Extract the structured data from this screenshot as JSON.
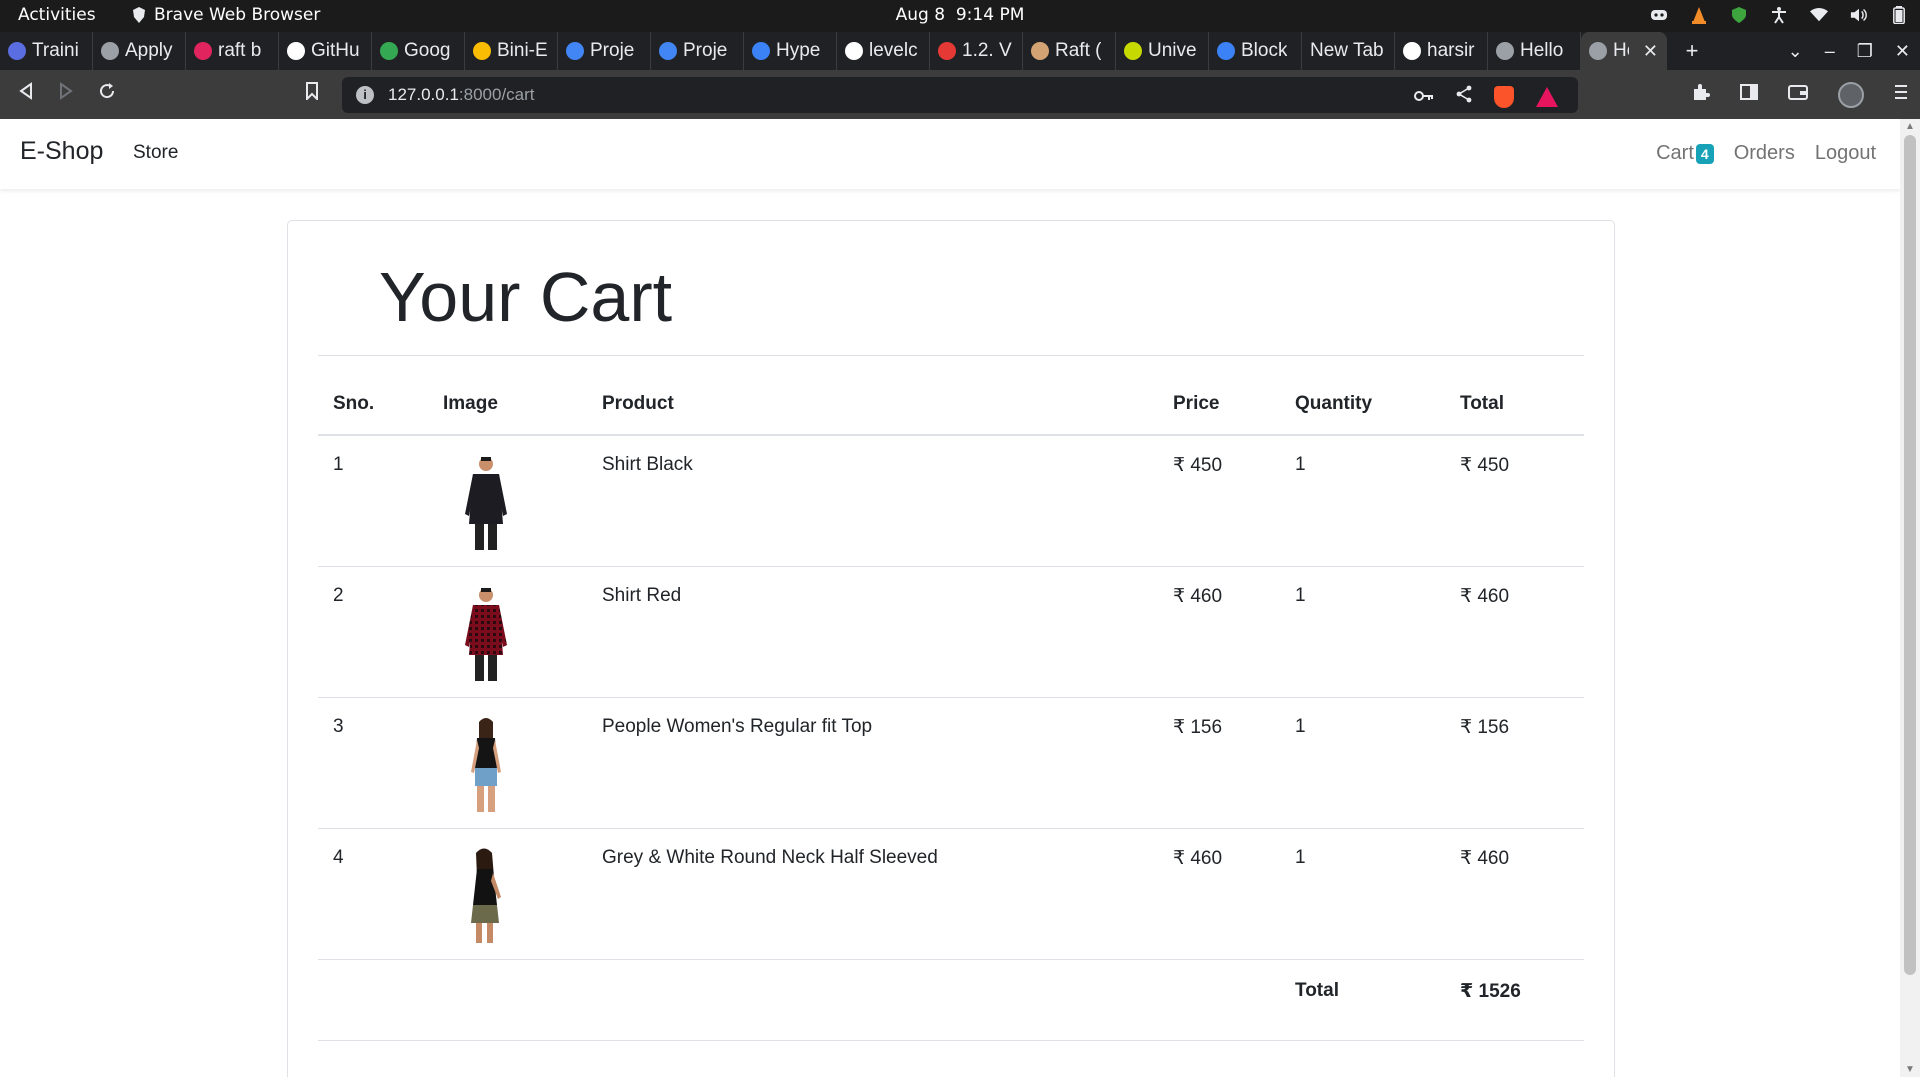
{
  "system_bar": {
    "activities": "Activities",
    "app_name": "Brave Web Browser",
    "date": "Aug 8",
    "time": "9:14 PM"
  },
  "tabs": [
    {
      "label": "Traini",
      "color": "#5b6ee1"
    },
    {
      "label": "Apply",
      "color": "#9aa0a6"
    },
    {
      "label": "raft b",
      "color": "#e0245e"
    },
    {
      "label": "GitHu",
      "color": "#ffffff"
    },
    {
      "label": "Goog",
      "color": "#34a853"
    },
    {
      "label": "Bini-E",
      "color": "#fbbc04"
    },
    {
      "label": "Proje",
      "color": "#4285f4"
    },
    {
      "label": "Proje",
      "color": "#4285f4"
    },
    {
      "label": "Hype",
      "color": "#3b82f6"
    },
    {
      "label": "levelc",
      "color": "#ffffff"
    },
    {
      "label": "1.2. V",
      "color": "#e53935"
    },
    {
      "label": "Raft (",
      "color": "#d4a373"
    },
    {
      "label": "Unive",
      "color": "#c6d900"
    },
    {
      "label": "Block",
      "color": "#3b82f6"
    },
    {
      "label": "New Tab",
      "color": ""
    },
    {
      "label": "harsir",
      "color": "#ffffff"
    },
    {
      "label": "Hello",
      "color": "#9aa0a6"
    }
  ],
  "active_tab": {
    "label": "He"
  },
  "address_bar": {
    "host": "127.0.0.1",
    "path": ":8000/cart"
  },
  "site": {
    "brand": "E-Shop",
    "nav_store": "Store",
    "nav_cart": "Cart",
    "cart_count": "4",
    "nav_orders": "Orders",
    "nav_logout": "Logout"
  },
  "cart": {
    "title": "Your Cart",
    "columns": [
      "Sno.",
      "Image",
      "Product",
      "Price",
      "Quantity",
      "Total"
    ],
    "rows": [
      {
        "sno": "1",
        "product": "Shirt Black",
        "price": "₹ 450",
        "quantity": "1",
        "total": "₹ 450",
        "image": "man-black-shirt"
      },
      {
        "sno": "2",
        "product": "Shirt Red",
        "price": "₹ 460",
        "quantity": "1",
        "total": "₹ 460",
        "image": "man-red-check-shirt"
      },
      {
        "sno": "3",
        "product": "People Women's Regular fit Top",
        "price": "₹ 156",
        "quantity": "1",
        "total": "₹ 156",
        "image": "woman-black-top"
      },
      {
        "sno": "4",
        "product": "Grey & White Round Neck Half Sleeved",
        "price": "₹ 460",
        "quantity": "1",
        "total": "₹ 460",
        "image": "woman-black-dress"
      }
    ],
    "total_label": "Total",
    "grand_total": "₹ 1526"
  },
  "colors": {
    "badge": "#17a2b8",
    "nav_link_muted": "#737373",
    "table_border": "#dee2e6"
  }
}
